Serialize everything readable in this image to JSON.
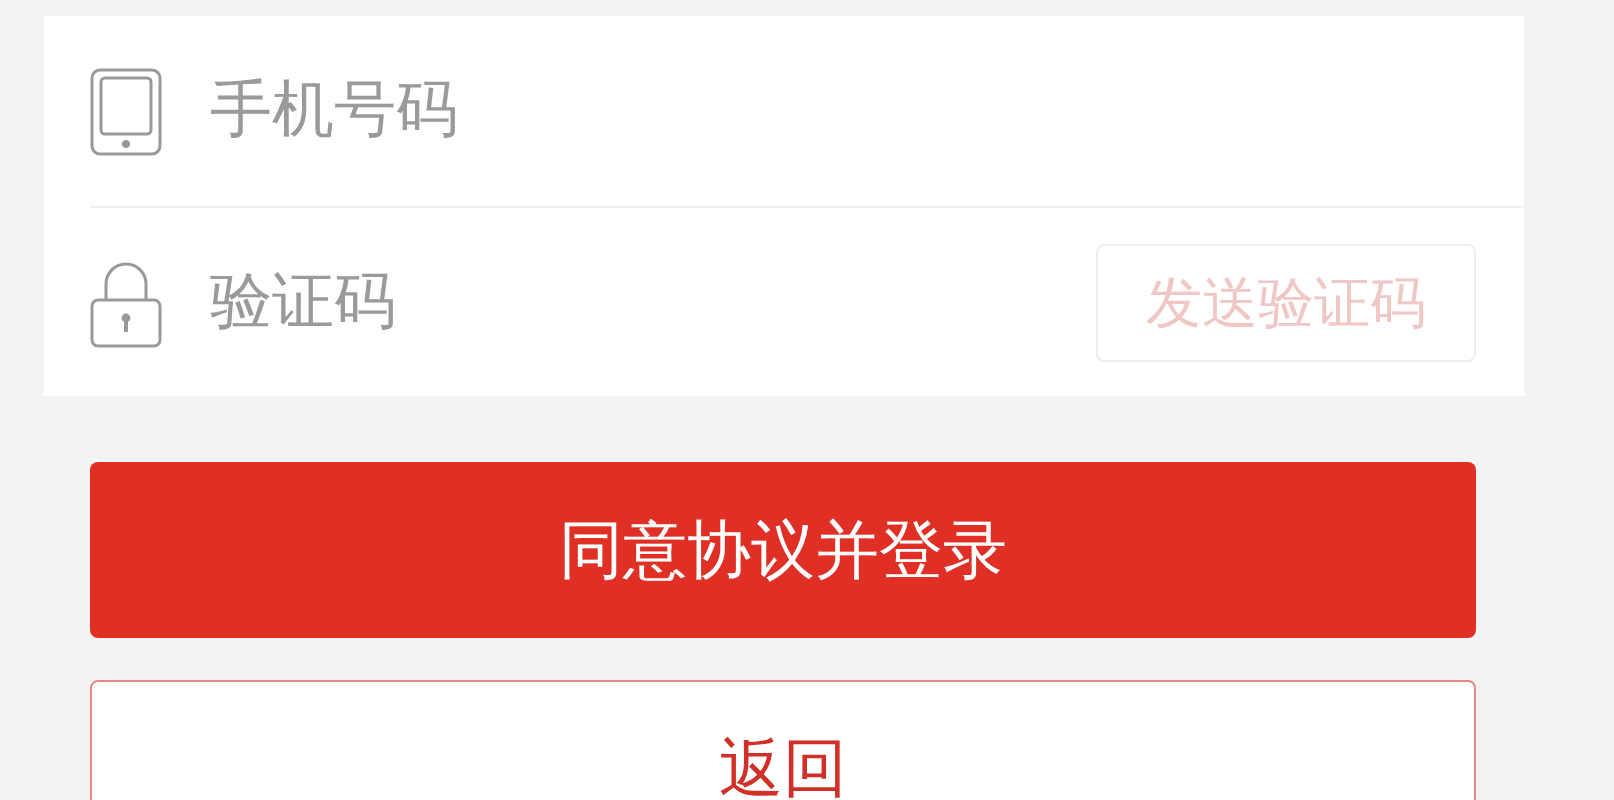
{
  "phone_field": {
    "placeholder": "手机号码"
  },
  "code_field": {
    "placeholder": "验证码"
  },
  "send_code_button": {
    "label": "发送验证码",
    "disabled": true
  },
  "buttons": [
    {
      "label": "同意协议并登录",
      "kind": "primary"
    },
    {
      "label": "返回",
      "kind": "outline"
    }
  ]
}
